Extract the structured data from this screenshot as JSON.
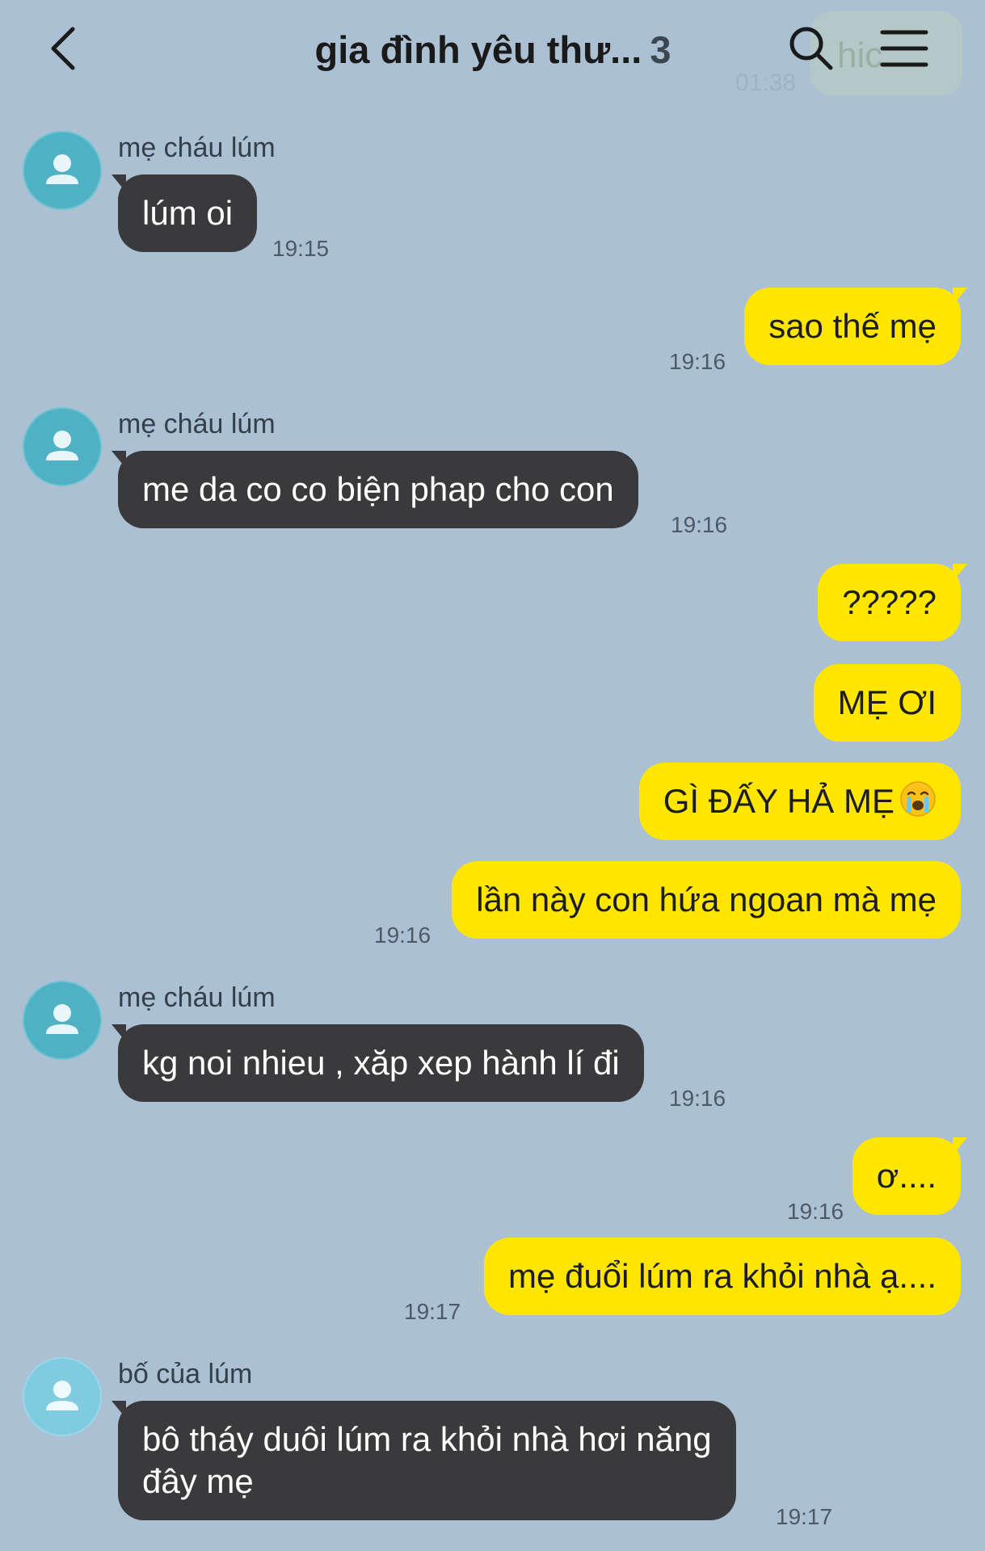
{
  "header": {
    "title": "gia đình yêu thư...",
    "member_count": "3",
    "ghost_preview_text": "hic",
    "ghost_preview_time": "01:38",
    "icons": [
      "chevron-left-icon",
      "search-icon",
      "hamburger-menu-icon"
    ]
  },
  "colors": {
    "background": "#abc1d3",
    "incoming_bubble": "#3a3a3c",
    "outgoing_bubble": "#fee600",
    "avatar_mother": "#4fb1c3",
    "avatar_father": "#7fcbe0"
  },
  "messages": [
    {
      "sender": "mẹ cháu lúm",
      "text": "lúm oi",
      "time": "19:15",
      "direction": "in"
    },
    {
      "text": "sao thế mẹ",
      "time": "19:16",
      "direction": "out"
    },
    {
      "sender": "mẹ cháu lúm",
      "text": "me da co co biện phap cho con",
      "time": "19:16",
      "direction": "in"
    },
    {
      "text": "?????",
      "direction": "out"
    },
    {
      "text": "MẸ ƠI",
      "direction": "out"
    },
    {
      "text": "GÌ ĐẤY HẢ MẸ",
      "emoji": "loudly-crying-face",
      "direction": "out"
    },
    {
      "text": "lần này con hứa ngoan mà mẹ",
      "time": "19:16",
      "direction": "out"
    },
    {
      "sender": "mẹ cháu lúm",
      "text": "kg noi nhieu , xăp xep hành lí đi",
      "time": "19:16",
      "direction": "in"
    },
    {
      "text": "ơ....",
      "time": "19:16",
      "direction": "out"
    },
    {
      "text": "mẹ đuổi lúm ra khỏi nhà ạ....",
      "time": "19:17",
      "direction": "out"
    },
    {
      "sender": "bố của lúm",
      "text_line1": "bô tháy duôi lúm ra khỏi nhà hơi năng",
      "text_line2": "đây mẹ",
      "time": "19:17",
      "direction": "in"
    }
  ]
}
